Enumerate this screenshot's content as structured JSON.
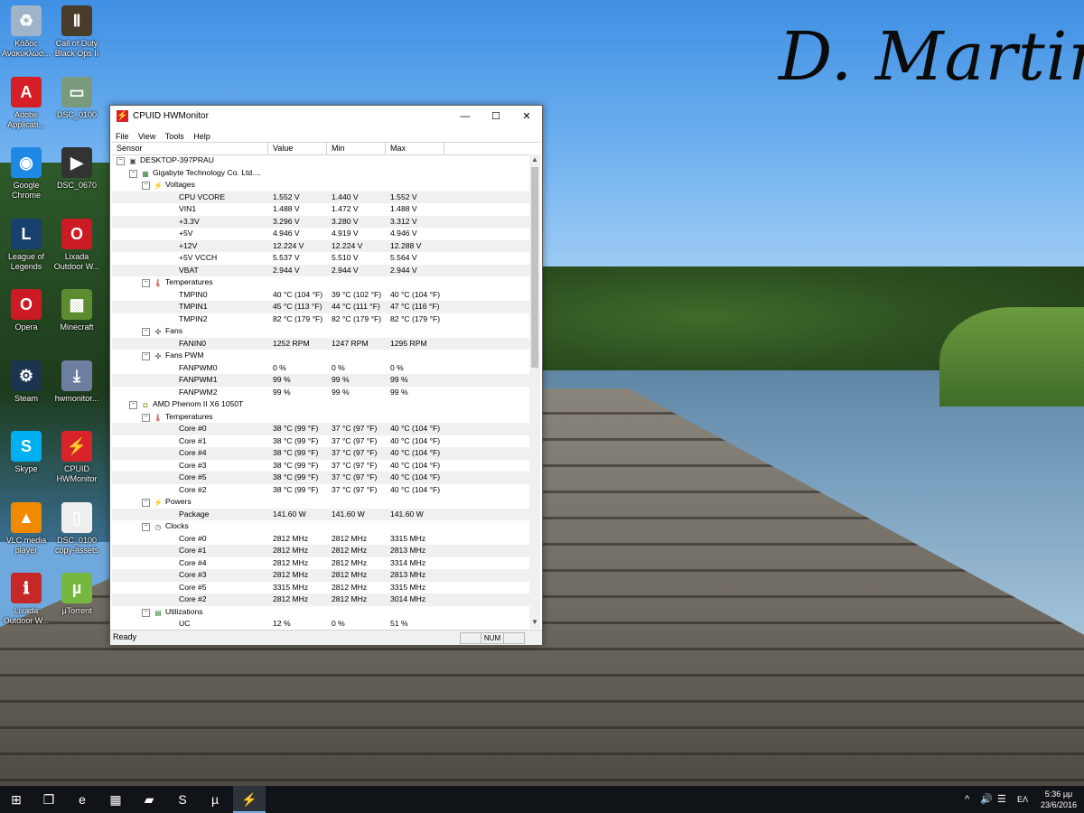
{
  "desktop": {
    "signature": "D. Martini",
    "icons": [
      {
        "label": "Κάδος Ανακύκλωσ...",
        "icon": "recycle-bin-icon",
        "color": "#9fb4c8"
      },
      {
        "label": "Call of Duty Black Ops II",
        "icon": "call-of-duty-icon",
        "color": "#4a3c2a"
      },
      {
        "label": "Adobe Applicati...",
        "icon": "adobe-icon",
        "color": "#d51f26"
      },
      {
        "label": "DSC_0100",
        "icon": "photo-icon",
        "color": "#7a9a7c"
      },
      {
        "label": "Google Chrome",
        "icon": "chrome-icon",
        "color": "#1e88e5"
      },
      {
        "label": "DSC_0670",
        "icon": "video-icon",
        "color": "#333333"
      },
      {
        "label": "League of Legends",
        "icon": "league-of-legends-icon",
        "color": "#17406d"
      },
      {
        "label": "Lixada Outdoor W...",
        "icon": "opera-icon",
        "color": "#cc1b24"
      },
      {
        "label": "Opera",
        "icon": "opera-icon",
        "color": "#cc1b24"
      },
      {
        "label": "Minecraft",
        "icon": "minecraft-icon",
        "color": "#5c8c2f"
      },
      {
        "label": "Steam",
        "icon": "steam-icon",
        "color": "#1b3550"
      },
      {
        "label": "hwmonitor...",
        "icon": "installer-icon",
        "color": "#6d7fa0"
      },
      {
        "label": "Skype",
        "icon": "skype-icon",
        "color": "#00aff0"
      },
      {
        "label": "CPUID HWMonitor",
        "icon": "hwmonitor-icon",
        "color": "#d8232a"
      },
      {
        "label": "VLC media player",
        "icon": "vlc-icon",
        "color": "#f08a00"
      },
      {
        "label": "DSC_0100 copy-assets",
        "icon": "file-icon",
        "color": "#eeeeee"
      },
      {
        "label": "Lixada Outdoor W...",
        "icon": "pdf-icon",
        "color": "#c62828"
      },
      {
        "label": "µTorrent",
        "icon": "utorrent-icon",
        "color": "#76b83f"
      }
    ]
  },
  "window": {
    "title": "CPUID HWMonitor",
    "controls": {
      "minimize": "—",
      "maximize": "☐",
      "close": "✕"
    },
    "menu": [
      "File",
      "View",
      "Tools",
      "Help"
    ],
    "columns": [
      "Sensor",
      "Value",
      "Min",
      "Max"
    ],
    "rows": [
      {
        "level": 0,
        "name": "DESKTOP-397PRAU",
        "type": "computer",
        "expander": "−"
      },
      {
        "level": 1,
        "name": "Gigabyte Technology Co. Ltd....",
        "type": "board",
        "expander": "−"
      },
      {
        "level": 2,
        "name": "Voltages",
        "type": "volt",
        "expander": "−"
      },
      {
        "level": 3,
        "name": "CPU VCORE",
        "value": "1.552 V",
        "min": "1.440 V",
        "max": "1.552 V"
      },
      {
        "level": 3,
        "name": "VIN1",
        "value": "1.488 V",
        "min": "1.472 V",
        "max": "1.488 V"
      },
      {
        "level": 3,
        "name": "+3.3V",
        "value": "3.296 V",
        "min": "3.280 V",
        "max": "3.312 V"
      },
      {
        "level": 3,
        "name": "+5V",
        "value": "4.946 V",
        "min": "4.919 V",
        "max": "4.946 V"
      },
      {
        "level": 3,
        "name": "+12V",
        "value": "12.224 V",
        "min": "12.224 V",
        "max": "12.288 V"
      },
      {
        "level": 3,
        "name": "+5V VCCH",
        "value": "5.537 V",
        "min": "5.510 V",
        "max": "5.564 V"
      },
      {
        "level": 3,
        "name": "VBAT",
        "value": "2.944 V",
        "min": "2.944 V",
        "max": "2.944 V"
      },
      {
        "level": 2,
        "name": "Temperatures",
        "type": "temp",
        "expander": "−"
      },
      {
        "level": 3,
        "name": "TMPIN0",
        "value": "40 °C  (104 °F)",
        "min": "39 °C  (102 °F)",
        "max": "40 °C  (104 °F)"
      },
      {
        "level": 3,
        "name": "TMPIN1",
        "value": "45 °C  (113 °F)",
        "min": "44 °C  (111 °F)",
        "max": "47 °C  (116 °F)"
      },
      {
        "level": 3,
        "name": "TMPIN2",
        "value": "82 °C  (179 °F)",
        "min": "82 °C  (179 °F)",
        "max": "82 °C  (179 °F)"
      },
      {
        "level": 2,
        "name": "Fans",
        "type": "fan",
        "expander": "−"
      },
      {
        "level": 3,
        "name": "FANIN0",
        "value": "1252 RPM",
        "min": "1247 RPM",
        "max": "1295 RPM"
      },
      {
        "level": 2,
        "name": "Fans PWM",
        "type": "fan",
        "expander": "−"
      },
      {
        "level": 3,
        "name": "FANPWM0",
        "value": "0 %",
        "min": "0 %",
        "max": "0 %"
      },
      {
        "level": 3,
        "name": "FANPWM1",
        "value": "99 %",
        "min": "99 %",
        "max": "99 %"
      },
      {
        "level": 3,
        "name": "FANPWM2",
        "value": "99 %",
        "min": "99 %",
        "max": "99 %"
      },
      {
        "level": 1,
        "name": "AMD Phenom II X6 1050T",
        "type": "cpu",
        "expander": "−"
      },
      {
        "level": 2,
        "name": "Temperatures",
        "type": "temp",
        "expander": "−"
      },
      {
        "level": 3,
        "name": "Core #0",
        "value": "38 °C  (99 °F)",
        "min": "37 °C  (97 °F)",
        "max": "40 °C  (104 °F)"
      },
      {
        "level": 3,
        "name": "Core #1",
        "value": "38 °C  (99 °F)",
        "min": "37 °C  (97 °F)",
        "max": "40 °C  (104 °F)"
      },
      {
        "level": 3,
        "name": "Core #4",
        "value": "38 °C  (99 °F)",
        "min": "37 °C  (97 °F)",
        "max": "40 °C  (104 °F)"
      },
      {
        "level": 3,
        "name": "Core #3",
        "value": "38 °C  (99 °F)",
        "min": "37 °C  (97 °F)",
        "max": "40 °C  (104 °F)"
      },
      {
        "level": 3,
        "name": "Core #5",
        "value": "38 °C  (99 °F)",
        "min": "37 °C  (97 °F)",
        "max": "40 °C  (104 °F)"
      },
      {
        "level": 3,
        "name": "Core #2",
        "value": "38 °C  (99 °F)",
        "min": "37 °C  (97 °F)",
        "max": "40 °C  (104 °F)"
      },
      {
        "level": 2,
        "name": "Powers",
        "type": "power",
        "expander": "−"
      },
      {
        "level": 3,
        "name": "Package",
        "value": "141.60 W",
        "min": "141.60 W",
        "max": "141.60 W"
      },
      {
        "level": 2,
        "name": "Clocks",
        "type": "clock",
        "expander": "−"
      },
      {
        "level": 3,
        "name": "Core #0",
        "value": "2812 MHz",
        "min": "2812 MHz",
        "max": "3315 MHz"
      },
      {
        "level": 3,
        "name": "Core #1",
        "value": "2812 MHz",
        "min": "2812 MHz",
        "max": "2813 MHz"
      },
      {
        "level": 3,
        "name": "Core #4",
        "value": "2812 MHz",
        "min": "2812 MHz",
        "max": "3314 MHz"
      },
      {
        "level": 3,
        "name": "Core #3",
        "value": "2812 MHz",
        "min": "2812 MHz",
        "max": "2813 MHz"
      },
      {
        "level": 3,
        "name": "Core #5",
        "value": "3315 MHz",
        "min": "2812 MHz",
        "max": "3315 MHz"
      },
      {
        "level": 3,
        "name": "Core #2",
        "value": "2812 MHz",
        "min": "2812 MHz",
        "max": "3014 MHz"
      },
      {
        "level": 2,
        "name": "Utilizations",
        "type": "util",
        "expander": "−"
      },
      {
        "level": 3,
        "name": "UC",
        "value": "12 %",
        "min": "0 %",
        "max": "51 %"
      }
    ],
    "status": {
      "text": "Ready",
      "num": "NUM"
    }
  },
  "taskbar": {
    "items": [
      {
        "icon": "windows-start-icon",
        "glyph": "⊞",
        "active": false
      },
      {
        "icon": "task-view-icon",
        "glyph": "❐",
        "active": false
      },
      {
        "icon": "edge-icon",
        "glyph": "e",
        "active": false
      },
      {
        "icon": "store-icon",
        "glyph": "▦",
        "active": false
      },
      {
        "icon": "file-explorer-icon",
        "glyph": "▰",
        "active": false
      },
      {
        "icon": "skype-icon",
        "glyph": "S",
        "active": false
      },
      {
        "icon": "utorrent-icon",
        "glyph": "µ",
        "active": false
      },
      {
        "icon": "hwmonitor-icon",
        "glyph": "⚡",
        "active": true
      }
    ],
    "tray": {
      "chevron": "^",
      "volume": "🔊",
      "notifications": "☰",
      "language": "ΕΛ",
      "time": "5:36 μμ",
      "date": "23/6/2016"
    }
  },
  "colors": {
    "accent": "#78aee0",
    "hwmonitor_red": "#d8232a",
    "taskbar": "#101418"
  }
}
